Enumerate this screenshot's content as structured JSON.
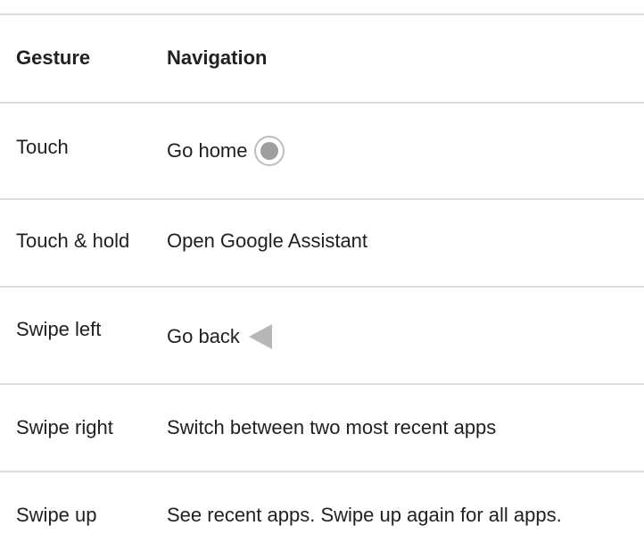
{
  "table": {
    "headers": {
      "gesture": "Gesture",
      "navigation": "Navigation"
    },
    "rows": [
      {
        "gesture": "Touch",
        "navigation": "Go home",
        "icon": "home-circle-icon"
      },
      {
        "gesture": "Touch & hold",
        "navigation": "Open Google Assistant"
      },
      {
        "gesture": "Swipe left",
        "navigation": "Go back",
        "icon": "back-triangle-icon"
      },
      {
        "gesture": "Swipe right",
        "navigation": "Switch between two most recent apps"
      },
      {
        "gesture": "Swipe up",
        "navigation": "See recent apps. Swipe up again for all apps."
      }
    ]
  },
  "colors": {
    "text": "#202124",
    "divider": "#dadce0",
    "icon_gray": "#9e9e9e"
  }
}
